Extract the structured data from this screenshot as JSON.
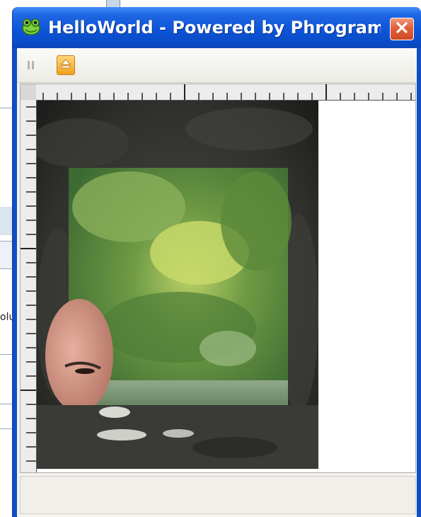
{
  "background_app": {
    "partial_text": "olu"
  },
  "window": {
    "title": "HelloWorld - Powered by Phrogram...",
    "icon": "frog-icon",
    "close_icon": "close-icon"
  },
  "toolbar": {
    "pause_icon": "pause-icon",
    "eject_icon": "eject-icon",
    "accent": "#f0a21a"
  },
  "canvas": {
    "image_icon": "photo-window-view"
  },
  "colors": {
    "titlebar": "#0d54d8",
    "close_button": "#e0603c",
    "client": "#f4f3ee"
  }
}
